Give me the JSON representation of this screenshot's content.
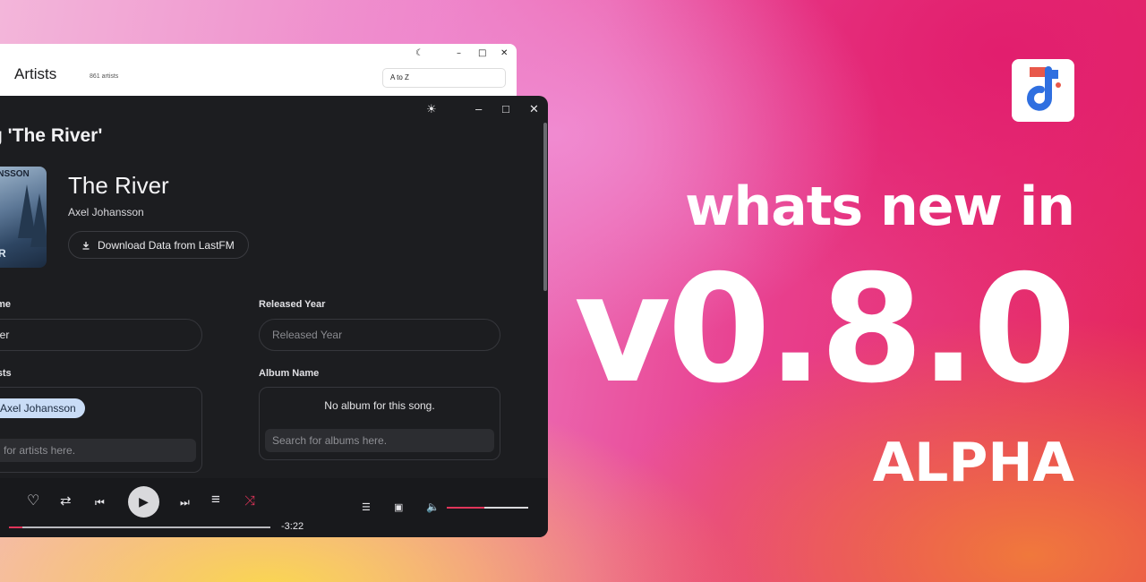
{
  "back_window": {
    "title": "Artists",
    "count": "861 artists",
    "sort_value": "A to Z"
  },
  "front_window": {
    "heading": "g 'The River'",
    "cover_top_text": "ANSSON",
    "cover_bottom_text": "ER",
    "song_title": "The River",
    "song_artist": "Axel Johansson",
    "lastfm_button": "Download Data from LastFM",
    "name_label": "ame",
    "name_value": "iver",
    "released_label": "Released Year",
    "released_placeholder": "Released Year",
    "artists_label": "tists",
    "artist_chip": "Axel Johansson",
    "artist_search_placeholder": "ch for artists here.",
    "album_label": "Album Name",
    "album_empty": "No album for this song.",
    "album_search_placeholder": "Search for albums here."
  },
  "player": {
    "remaining_time": "-3:22",
    "progress": 0.05,
    "volume": 0.46
  },
  "promo": {
    "line1": "whats new in",
    "version": "v0.8.0",
    "tag": "ALPHA"
  },
  "colors": {
    "accent": "#e0355a",
    "chip": "#c9dcf6",
    "logo_blue": "#2f6fe0",
    "logo_red": "#e8584a"
  }
}
